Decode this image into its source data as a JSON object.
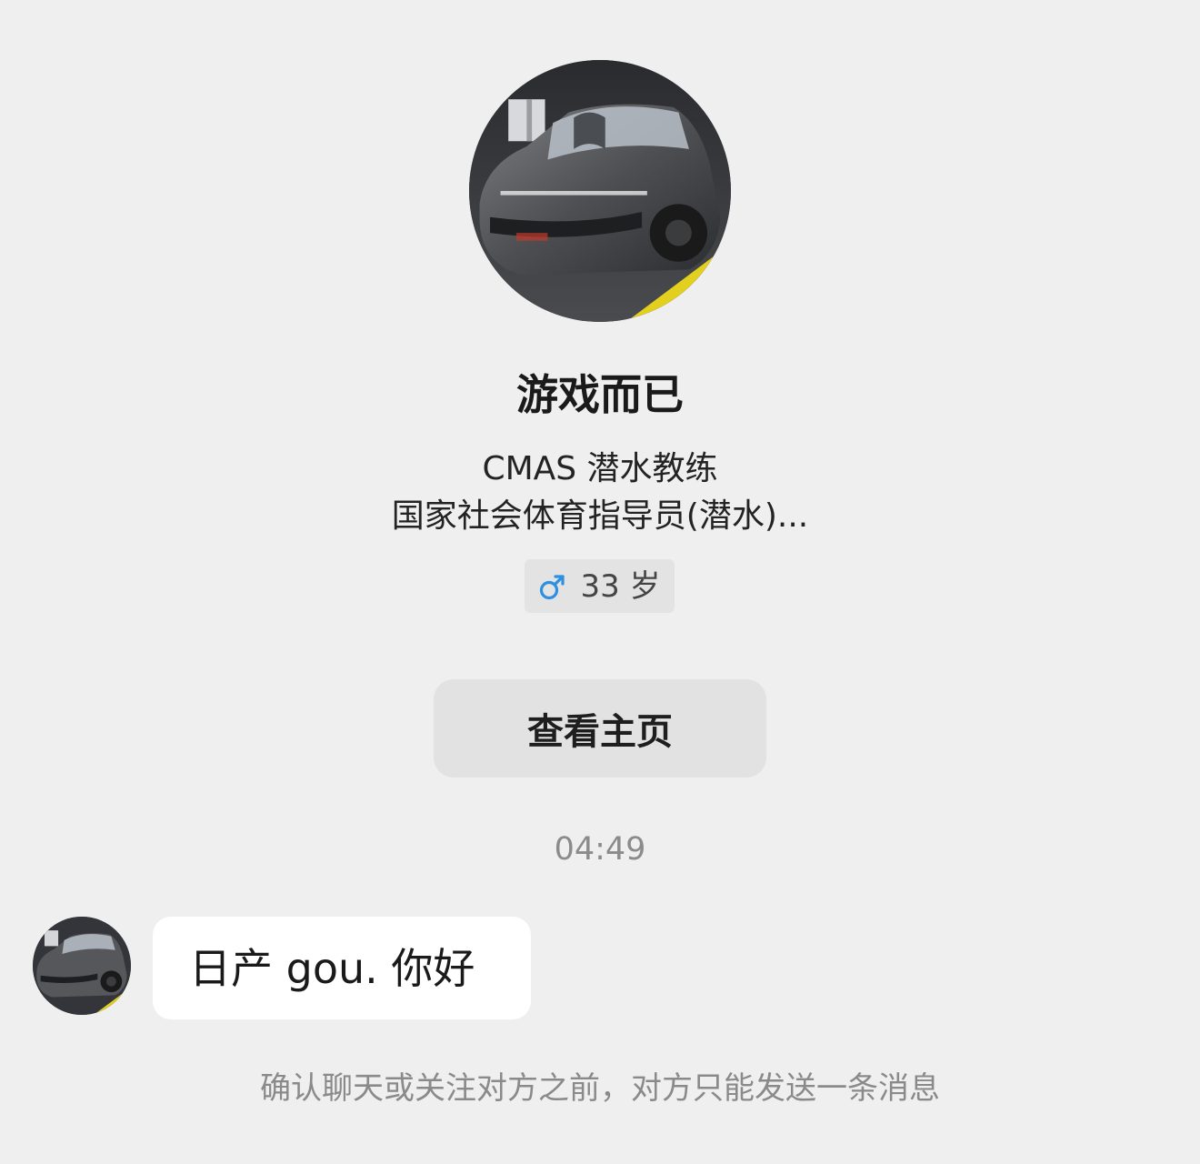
{
  "profile": {
    "avatar_icon": "car-photo-avatar",
    "name": "游戏而已",
    "bio_lines": [
      "CMAS 潜水教练",
      "国家社会体育指导员(潜水)..."
    ],
    "gender_icon": "male-symbol-icon",
    "gender_color": "#2f8fe0",
    "gender_glyph": "♂",
    "age": "33 岁",
    "view_profile_label": "查看主页"
  },
  "chat": {
    "timestamp": "04:49",
    "messages": [
      {
        "from": "other",
        "avatar_icon": "car-photo-avatar",
        "text": "日产 gou.  你好"
      }
    ],
    "notice": "确认聊天或关注对方之前，对方只能发送一条消息"
  },
  "colors": {
    "background": "#efefef",
    "bubble": "#ffffff",
    "button": "#e2e2e2",
    "tag": "#e3e3e3"
  }
}
